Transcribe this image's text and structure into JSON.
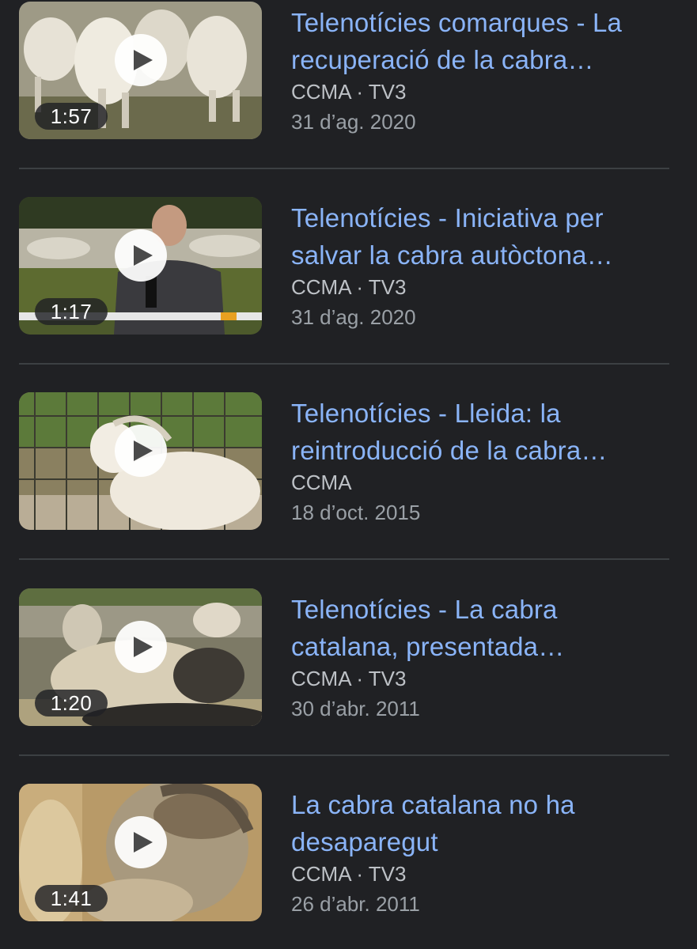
{
  "results": [
    {
      "title_line1": "Telenotícies comarques - La",
      "title_line2": "recuperació de la cabra…",
      "source": "CCMA · TV3",
      "date": "31 d’ag. 2020",
      "duration": "1:57"
    },
    {
      "title_line1": "Telenotícies - Iniciativa per",
      "title_line2": "salvar la cabra autòctona…",
      "source": "CCMA · TV3",
      "date": "31 d’ag. 2020",
      "duration": "1:17"
    },
    {
      "title_line1": "Telenotícies - Lleida: la",
      "title_line2": "reintroducció de la cabra…",
      "source": "CCMA",
      "date": "18 d’oct. 2015",
      "duration": ""
    },
    {
      "title_line1": "Telenotícies - La cabra",
      "title_line2": "catalana, presentada…",
      "source": "CCMA · TV3",
      "date": "30 d’abr. 2011",
      "duration": "1:20"
    },
    {
      "title_line1": "La cabra catalana no ha",
      "title_line2": "desaparegut",
      "source": "CCMA · TV3",
      "date": "26 d’abr. 2011",
      "duration": "1:41"
    }
  ],
  "colors": {
    "background": "#202124",
    "title": "#8ab4f8",
    "source": "#bdc1c6",
    "date": "#9aa0a6",
    "divider": "#3c4043"
  },
  "icons": {
    "play": "play-icon"
  }
}
